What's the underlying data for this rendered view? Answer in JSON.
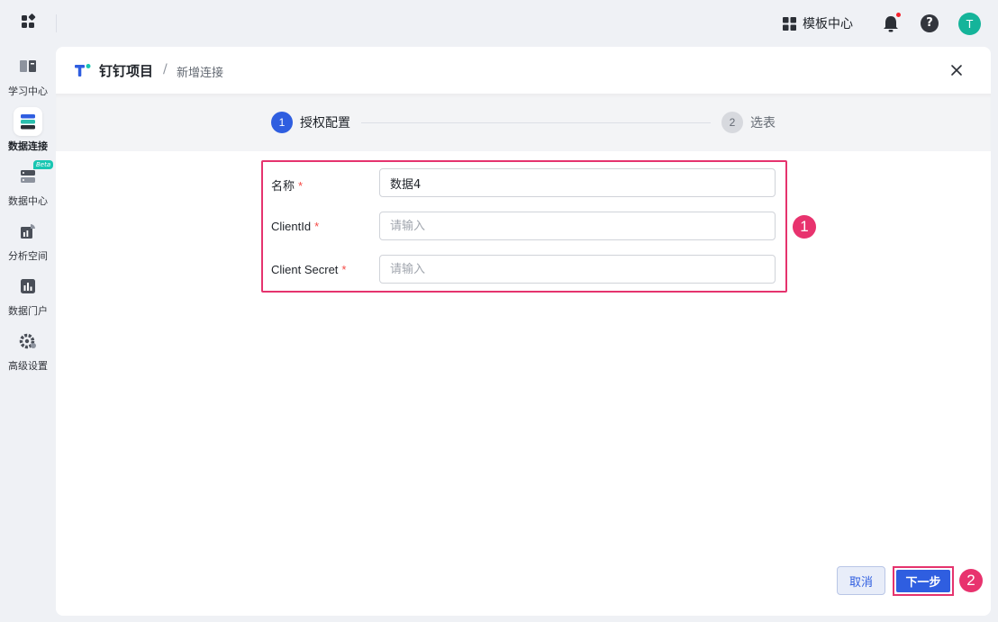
{
  "topbar": {
    "template_center_label": "模板中心",
    "avatar_initial": "T",
    "colors": {
      "avatar": "#15b49a",
      "notification_dot": "#f5222d"
    }
  },
  "sidebar": {
    "items": [
      {
        "label": "学习中心",
        "icon": "book-icon",
        "active": false
      },
      {
        "label": "数据连接",
        "icon": "data-connect-icon",
        "active": true
      },
      {
        "label": "数据中心",
        "icon": "database-icon",
        "active": false,
        "badge": "Beta"
      },
      {
        "label": "分析空间",
        "icon": "analysis-icon",
        "active": false
      },
      {
        "label": "数据门户",
        "icon": "portal-chart-icon",
        "active": false
      },
      {
        "label": "高级设置",
        "icon": "gear-icon",
        "active": false
      }
    ]
  },
  "panel": {
    "brand": "钉钉项目",
    "breadcrumb_sep": "/",
    "breadcrumb": "新增连接"
  },
  "steps": [
    {
      "number": "1",
      "label": "授权配置",
      "active": true
    },
    {
      "number": "2",
      "label": "选表",
      "active": false
    }
  ],
  "form": {
    "fields": [
      {
        "label": "名称",
        "required_mark": "*",
        "value": "数据4",
        "placeholder": ""
      },
      {
        "label": "ClientId",
        "required_mark": "*",
        "value": "",
        "placeholder": "请输入"
      },
      {
        "label": "Client Secret",
        "required_mark": "*",
        "value": "",
        "placeholder": "请输入"
      }
    ]
  },
  "actions": {
    "cancel": "取消",
    "next": "下一步"
  },
  "annotations": {
    "badge1": "1",
    "badge2": "2",
    "color": "#e5336e"
  },
  "colors": {
    "primary": "#2f5ee0"
  }
}
